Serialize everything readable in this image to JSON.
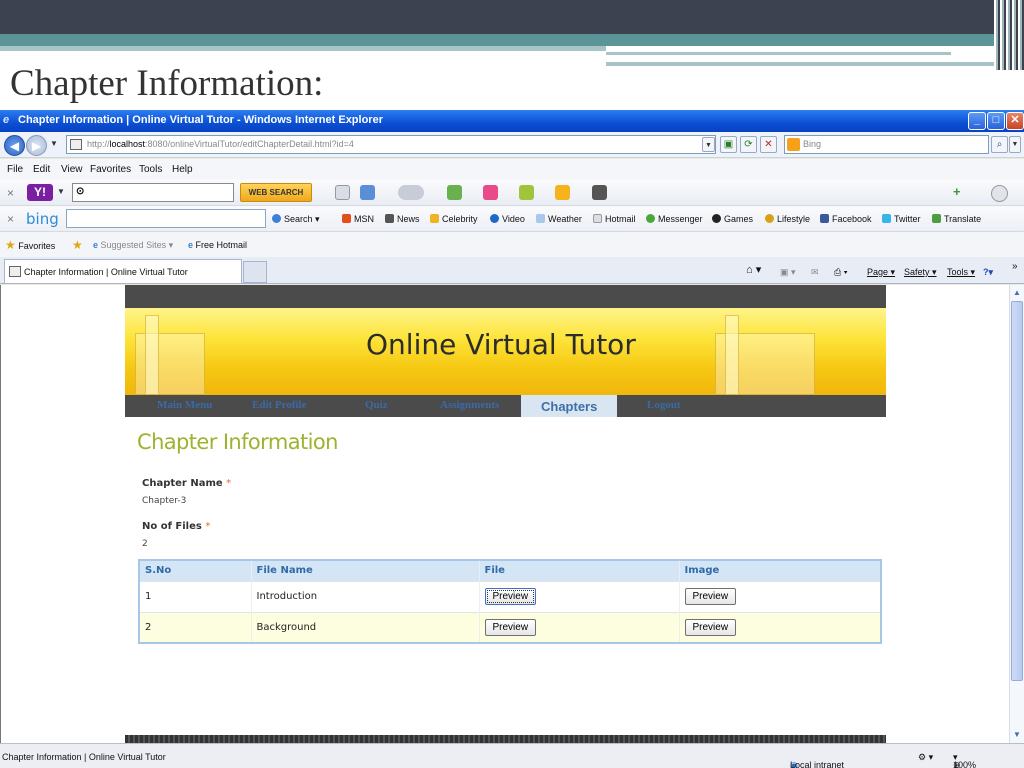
{
  "slide": {
    "title": "Chapter Information:"
  },
  "window": {
    "title": "Chapter Information | Online Virtual Tutor - Windows Internet Explorer",
    "address_proto": "http://",
    "address_host": "localhost",
    "address_rest": ":8080/onlineVirtualTutor/editChapterDetail.html?id=4",
    "search_placeholder": "Bing",
    "menu": [
      "File",
      "Edit",
      "View",
      "Favorites",
      "Tools",
      "Help"
    ],
    "yahoo_search_button": "WEB SEARCH",
    "bing_toolbar": {
      "search": "Search",
      "items": [
        "MSN",
        "News",
        "Celebrity",
        "Video",
        "Weather",
        "Hotmail",
        "Messenger",
        "Games",
        "Lifestyle",
        "Facebook",
        "Twitter",
        "Translate"
      ]
    },
    "favorites": {
      "label": "Favorites",
      "suggested": "Suggested Sites",
      "free_hotmail": "Free Hotmail"
    },
    "tab_title": "Chapter Information | Online Virtual Tutor",
    "command_bar": {
      "page": "Page",
      "safety": "Safety",
      "tools": "Tools"
    },
    "status": {
      "text": "Chapter Information | Online Virtual Tutor",
      "zone": "Local intranet",
      "zoom": "100%"
    }
  },
  "site": {
    "banner_title": "Online Virtual Tutor",
    "nav": [
      "Main Menu",
      "Edit Profile",
      "Quiz",
      "Assignments",
      "Chapters",
      "Logout"
    ],
    "active_nav": "Chapters",
    "heading": "Chapter Information",
    "chapter_name_label": "Chapter Name",
    "chapter_name": "Chapter-3",
    "no_files_label": "No of Files",
    "no_files": "2",
    "required_mark": "*",
    "table": {
      "headers": [
        "S.No",
        "File Name",
        "File",
        "Image"
      ],
      "rows": [
        {
          "sno": "1",
          "name": "Introduction",
          "file": "Preview",
          "image": "Preview"
        },
        {
          "sno": "2",
          "name": "Background",
          "file": "Preview",
          "image": "Preview"
        }
      ]
    }
  }
}
